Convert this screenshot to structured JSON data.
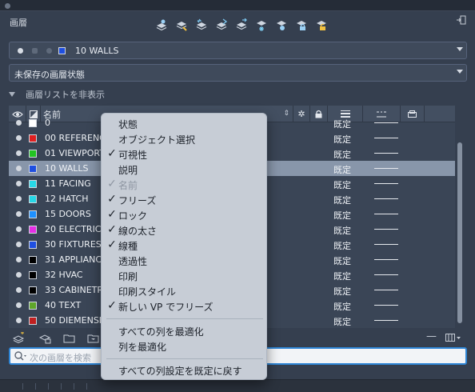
{
  "panel": {
    "title": "画層",
    "current_layer": "10 WALLS",
    "current_layer_color": "#1f4fe0",
    "layer_state": "未保存の画層状態",
    "list_toggle_label": "画層リストを非表示"
  },
  "toolbar_icons": [
    "layer-properties-icon",
    "match-layer-icon",
    "previous-layer-icon",
    "isolate-layer-icon",
    "unisolate-layer-icon",
    "freeze-layer-icon",
    "off-layer-icon",
    "lock-layer-icon",
    "unlock-layer-icon"
  ],
  "table": {
    "name_header": "名前",
    "rows": [
      {
        "name": "0",
        "color": "#ffffff",
        "linetype": "既定",
        "selected": false
      },
      {
        "name": "00 REFERENCE",
        "color": "#e02020",
        "linetype": "既定",
        "selected": false
      },
      {
        "name": "01 VIEWPORT",
        "color": "#22c322",
        "linetype": "既定",
        "selected": false
      },
      {
        "name": "10 WALLS",
        "color": "#1f4fe0",
        "linetype": "既定",
        "selected": true
      },
      {
        "name": "11 FACING",
        "color": "#26d7e6",
        "linetype": "既定",
        "selected": false
      },
      {
        "name": "12 HATCH",
        "color": "#26d7e6",
        "linetype": "既定",
        "selected": false
      },
      {
        "name": "15 DOORS",
        "color": "#1e90ff",
        "linetype": "既定",
        "selected": false
      },
      {
        "name": "20 ELECTRICAL",
        "color": "#e62ee6",
        "linetype": "既定",
        "selected": false
      },
      {
        "name": "30 FIXTURES",
        "color": "#1f4fe0",
        "linetype": "既定",
        "selected": false
      },
      {
        "name": "31 APPLIANCES",
        "color": "#000000",
        "linetype": "既定",
        "selected": false
      },
      {
        "name": "32 HVAC",
        "color": "#000000",
        "linetype": "既定",
        "selected": false
      },
      {
        "name": "33 CABINETRY",
        "color": "#000000",
        "linetype": "既定",
        "selected": false
      },
      {
        "name": "40 TEXT",
        "color": "#5fa62a",
        "linetype": "既定",
        "selected": false
      },
      {
        "name": "50 DIEMENSIONS",
        "color": "#c02020",
        "linetype": "既定",
        "selected": false
      }
    ]
  },
  "search": {
    "placeholder": "次の画層を検索"
  },
  "context_menu": {
    "items": [
      {
        "label": "状態",
        "checked": false,
        "disabled": false
      },
      {
        "label": "オブジェクト選択",
        "checked": false,
        "disabled": false
      },
      {
        "label": "可視性",
        "checked": true,
        "disabled": false
      },
      {
        "label": "説明",
        "checked": false,
        "disabled": false
      },
      {
        "label": "名前",
        "checked": true,
        "disabled": true
      },
      {
        "label": "フリーズ",
        "checked": true,
        "disabled": false
      },
      {
        "label": "ロック",
        "checked": true,
        "disabled": false
      },
      {
        "label": "線の太さ",
        "checked": true,
        "disabled": false
      },
      {
        "label": "線種",
        "checked": true,
        "disabled": false
      },
      {
        "label": "透過性",
        "checked": false,
        "disabled": false
      },
      {
        "label": "印刷",
        "checked": false,
        "disabled": false
      },
      {
        "label": "印刷スタイル",
        "checked": false,
        "disabled": false
      },
      {
        "label": "新しい VP でフリーズ",
        "checked": true,
        "disabled": false
      }
    ],
    "actions": [
      {
        "label": "すべての列を最適化"
      },
      {
        "label": "列を最適化"
      }
    ],
    "reset": {
      "label": "すべての列設定を既定に戻す"
    }
  },
  "colors": {
    "panel_bg": "#353f4f",
    "selection": "#8896aa",
    "search_focus": "#2f86d6"
  }
}
